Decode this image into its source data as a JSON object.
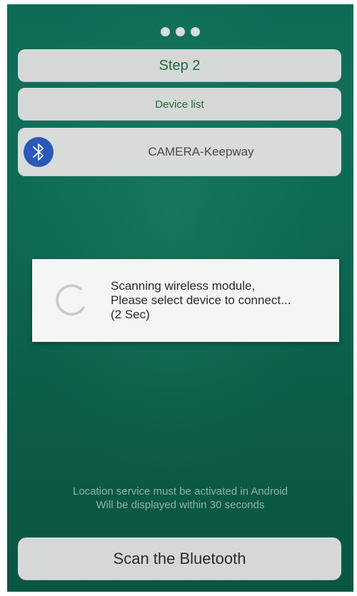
{
  "header": {
    "page_indicator_count": 3,
    "step_title": "Step 2",
    "device_list_label": "Device list"
  },
  "devices": [
    {
      "name": "CAMERA-Keepway",
      "icon": "bluetooth-icon"
    }
  ],
  "dialog": {
    "line1": "Scanning wireless module,",
    "line2": "Please select device to connect...",
    "line3": "(2 Sec)",
    "icon": "loading-spinner-icon"
  },
  "notice": {
    "line1": "Location service must be activated in Android",
    "line2": "Will be displayed within 30 seconds"
  },
  "actions": {
    "scan_label": "Scan the Bluetooth"
  },
  "colors": {
    "background": "#0d6650",
    "panel": "#d6d8d8",
    "title_text": "#1f6b3b",
    "bluetooth_badge": "#2b59b8",
    "notice_text": "#8fb2a5"
  }
}
